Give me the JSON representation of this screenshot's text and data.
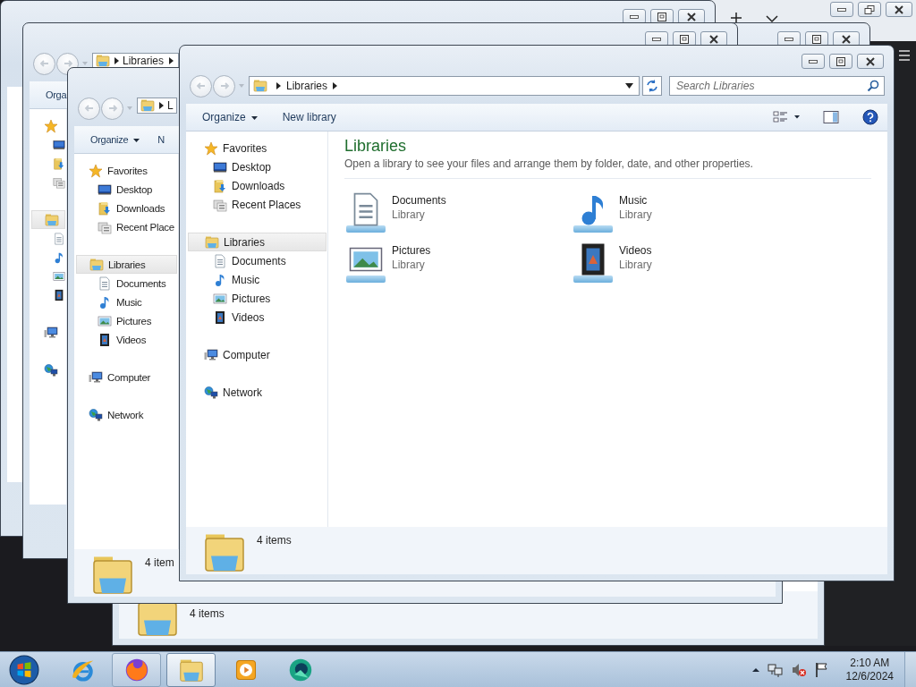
{
  "windows": [
    {
      "kind": "explorer"
    },
    {
      "kind": "explorer"
    },
    {
      "kind": "explorer",
      "status": {
        "text": "4 items"
      }
    },
    {
      "kind": "explorer",
      "nav": {
        "address": {
          "crumbs": [
            "Libraries"
          ],
          "trailing_separator": true
        }
      },
      "commands": [
        {
          "label": "Orga",
          "kind": "button"
        }
      ],
      "sidebar": [
        {
          "kind": "favorites",
          "selected": false,
          "children": [
            {
              "kind": "desktop",
              "selected": false
            },
            {
              "kind": "downloads",
              "selected": false
            },
            {
              "kind": "recent",
              "selected": false
            }
          ]
        },
        {
          "kind": "libraries",
          "selected": true,
          "children": [
            {
              "kind": "documents",
              "selected": false
            },
            {
              "kind": "music",
              "selected": false
            },
            {
              "kind": "pictures",
              "selected": false
            },
            {
              "kind": "videos",
              "selected": false
            }
          ]
        },
        {
          "kind": "computer",
          "selected": false
        },
        {
          "kind": "network",
          "selected": false
        }
      ]
    },
    {
      "kind": "explorer",
      "nav": {
        "address": {
          "crumbs": [
            "L"
          ],
          "trailing_separator": false
        }
      },
      "commands": [
        {
          "label": "Organize",
          "kind": "menu"
        },
        {
          "label": "N",
          "kind": "button"
        }
      ],
      "sidebar": [
        {
          "kind": "favorites",
          "label": "Favorites",
          "selected": false,
          "children": [
            {
              "kind": "desktop",
              "label": "Desktop",
              "selected": false
            },
            {
              "kind": "downloads",
              "label": "Downloads",
              "selected": false
            },
            {
              "kind": "recent",
              "label": "Recent Place",
              "selected": false
            }
          ]
        },
        {
          "kind": "libraries",
          "label": "Libraries",
          "selected": true,
          "children": [
            {
              "kind": "documents",
              "label": "Documents",
              "selected": false
            },
            {
              "kind": "music",
              "label": "Music",
              "selected": false
            },
            {
              "kind": "pictures",
              "label": "Pictures",
              "selected": false
            },
            {
              "kind": "videos",
              "label": "Videos",
              "selected": false
            }
          ]
        },
        {
          "kind": "computer",
          "label": "Computer",
          "selected": false
        },
        {
          "kind": "network",
          "label": "Network",
          "selected": false
        }
      ],
      "status": {
        "text": "4 item"
      }
    },
    {
      "kind": "explorer",
      "nav": {
        "address": {
          "crumbs": [
            "Libraries"
          ],
          "trailing_separator": true
        },
        "search": {
          "placeholder": "Search Libraries"
        }
      },
      "commands": [
        {
          "label": "Organize",
          "kind": "menu"
        },
        {
          "label": "New library",
          "kind": "button"
        }
      ],
      "view_tools": true,
      "sidebar": [
        {
          "kind": "favorites",
          "label": "Favorites",
          "selected": false,
          "children": [
            {
              "kind": "desktop",
              "label": "Desktop",
              "selected": false
            },
            {
              "kind": "downloads",
              "label": "Downloads",
              "selected": false
            },
            {
              "kind": "recent",
              "label": "Recent Places",
              "selected": false
            }
          ]
        },
        {
          "kind": "libraries",
          "label": "Libraries",
          "selected": true,
          "children": [
            {
              "kind": "documents",
              "label": "Documents",
              "selected": false
            },
            {
              "kind": "music",
              "label": "Music",
              "selected": false
            },
            {
              "kind": "pictures",
              "label": "Pictures",
              "selected": false
            },
            {
              "kind": "videos",
              "label": "Videos",
              "selected": false
            }
          ]
        },
        {
          "kind": "computer",
          "label": "Computer",
          "selected": false
        },
        {
          "kind": "network",
          "label": "Network",
          "selected": false
        }
      ],
      "content": {
        "title": "Libraries",
        "description": "Open a library to see your files and arrange them by folder, date, and other properties.",
        "items": [
          {
            "kind": "documents",
            "name": "Documents",
            "type": "Library"
          },
          {
            "kind": "music",
            "name": "Music",
            "type": "Library"
          },
          {
            "kind": "pictures",
            "name": "Pictures",
            "type": "Library"
          },
          {
            "kind": "videos",
            "name": "Videos",
            "type": "Library"
          }
        ]
      },
      "status": {
        "text": "4 items"
      }
    }
  ],
  "taskbar": {
    "items": [
      {
        "kind": "start",
        "running": false,
        "selected": false
      },
      {
        "kind": "ie",
        "running": false,
        "selected": false
      },
      {
        "kind": "firefox",
        "running": true,
        "selected": false
      },
      {
        "kind": "explorer",
        "running": true,
        "selected": true
      },
      {
        "kind": "media",
        "running": false,
        "selected": false
      },
      {
        "kind": "app",
        "running": false,
        "selected": false
      }
    ],
    "tray": {
      "time": "2:10 AM",
      "date": "12/6/2024"
    }
  }
}
